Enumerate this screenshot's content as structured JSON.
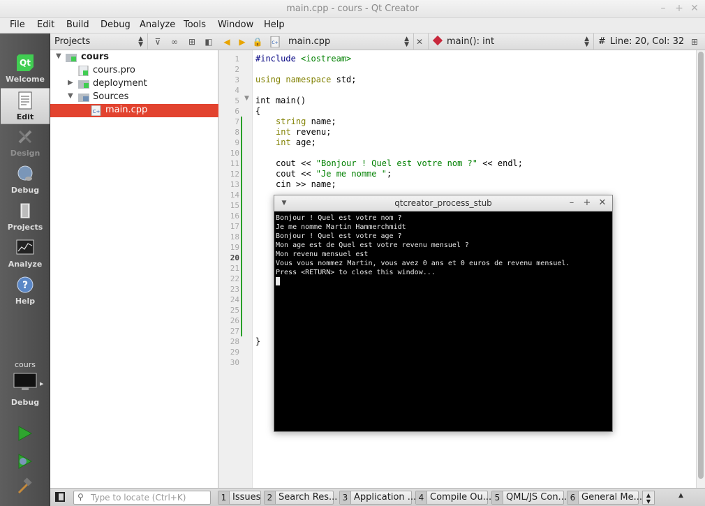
{
  "window": {
    "title": "main.cpp - cours - Qt Creator"
  },
  "menu": [
    "File",
    "Edit",
    "Build",
    "Debug",
    "Analyze",
    "Tools",
    "Window",
    "Help"
  ],
  "modes": {
    "welcome": "Welcome",
    "edit": "Edit",
    "design": "Design",
    "debug": "Debug",
    "projects": "Projects",
    "analyze": "Analyze",
    "help": "Help"
  },
  "kit": {
    "project": "cours",
    "build_mode": "Debug"
  },
  "projects_pane": {
    "selector": "Projects",
    "tree": [
      {
        "label": "cours"
      },
      {
        "label": "cours.pro"
      },
      {
        "label": "deployment"
      },
      {
        "label": "Sources"
      },
      {
        "label": "main.cpp"
      }
    ]
  },
  "editor_toolbar": {
    "file": "main.cpp",
    "symbol": "main(): int",
    "hash": "#",
    "position": "Line: 20, Col: 32"
  },
  "line_numbers": [
    "1",
    "2",
    "3",
    "4",
    "5",
    "6",
    "7",
    "8",
    "9",
    "10",
    "11",
    "12",
    "13",
    "14",
    "15",
    "16",
    "17",
    "18",
    "19",
    "20",
    "21",
    "22",
    "23",
    "24",
    "25",
    "26",
    "27",
    "28",
    "29",
    "30"
  ],
  "code": {
    "l1_pp": "#include",
    "l1_inc": "<iostream>",
    "l3_kw": "using namespace",
    "l3_rest": " std;",
    "l5": "int main()",
    "l6": "{",
    "l7_kw": "string",
    "l7_rest": " name;",
    "l8_kw": "int",
    "l8_rest": " revenu;",
    "l9_kw": "int",
    "l9_rest": " age;",
    "l11_a": "cout << ",
    "l11_str": "\"Bonjour ! Quel est votre nom ?\"",
    "l11_b": " << endl;",
    "l12_a": "cout << ",
    "l12_str": "\"Je me nomme \"",
    "l12_b": ";",
    "l13": "cin >> name;",
    "l28": "}"
  },
  "terminal": {
    "title": "qtcreator_process_stub",
    "lines": [
      "Bonjour ! Quel est votre nom ?",
      "Je me nomme Martin Hammerchmidt",
      "Bonjour ! Quel est votre age ?",
      "Mon age est de Quel est votre revenu mensuel ?",
      "Mon revenu mensuel est",
      "Vous vous nommez Martin, vous avez 0 ans et 0 euros de revenu mensuel.",
      "Press <RETURN> to close this window..."
    ]
  },
  "bottom": {
    "locator_placeholder": "Type to locate (Ctrl+K)",
    "tabs": [
      {
        "num": "1",
        "label": "Issues"
      },
      {
        "num": "2",
        "label": "Search Res..."
      },
      {
        "num": "3",
        "label": "Application ..."
      },
      {
        "num": "4",
        "label": "Compile Ou..."
      },
      {
        "num": "5",
        "label": "QML/JS Con..."
      },
      {
        "num": "6",
        "label": "General Me..."
      }
    ]
  },
  "colors": {
    "accent": "#e2432f",
    "qt_green": "#41cd52",
    "run_green": "#2fa52f"
  }
}
